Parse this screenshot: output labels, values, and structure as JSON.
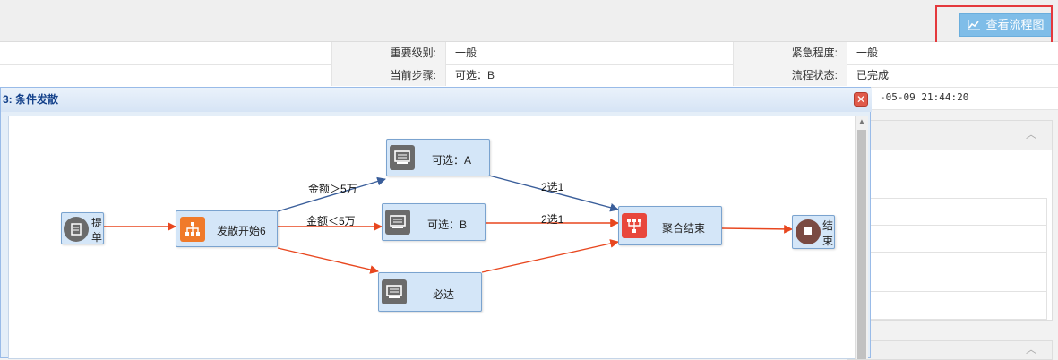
{
  "toolbar": {
    "flow_button_label": "查看流程图",
    "flow_button_icon": "chart-icon"
  },
  "info": {
    "row1": {
      "importance_label": "重要级别:",
      "importance_value": "一般",
      "urgency_label": "紧急程度:",
      "urgency_value": "一般"
    },
    "row2": {
      "current_step_label": "当前步骤:",
      "current_step_value": "可选：B",
      "flow_status_label": "流程状态:",
      "flow_status_value": "已完成"
    },
    "row3": {
      "time_value": "-05-09 21:44:20"
    }
  },
  "dialog": {
    "title": "3: 条件发散",
    "close_icon": "close-icon"
  },
  "flow": {
    "nodes": {
      "start": {
        "label_line1": "提",
        "label_line2": "单",
        "icon": "form-icon"
      },
      "fork": {
        "label": "发散开始6",
        "icon": "org-tree-icon"
      },
      "opt_a": {
        "label": "可选：A",
        "icon": "monitor-icon"
      },
      "opt_b": {
        "label": "可选：B",
        "icon": "monitor-icon"
      },
      "must": {
        "label": "必达",
        "icon": "monitor-icon"
      },
      "join": {
        "label": "聚合结束",
        "icon": "join-icon"
      },
      "end": {
        "label_line1": "结",
        "label_line2": "束",
        "icon": "stop-icon"
      }
    },
    "edges": {
      "fork_to_a": "金额＞5万",
      "fork_to_b": "金额＜5万",
      "a_to_join": "2选1",
      "b_to_join": "2选1"
    }
  },
  "colors": {
    "edge_red": "#e8471f",
    "edge_blue": "#3a5e9a",
    "node_fill": "#d4e6f8",
    "button": "#7fbde8",
    "highlight": "#e4393c"
  }
}
